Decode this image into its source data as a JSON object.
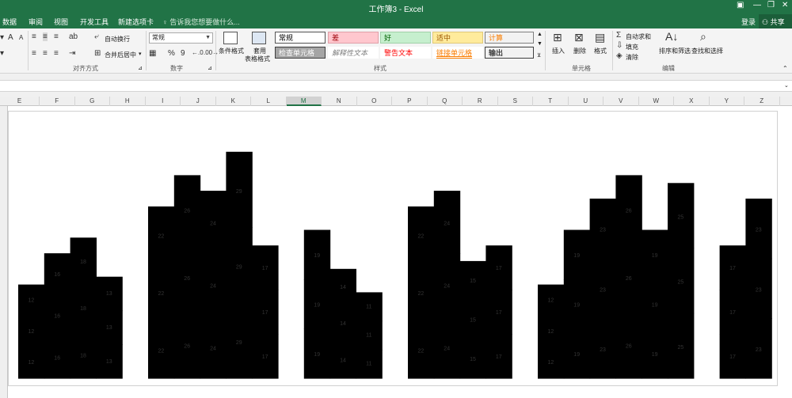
{
  "window": {
    "title": "工作簿3 - Excel",
    "controls": [
      "▣",
      "—",
      "❐",
      "✕"
    ]
  },
  "tabs": [
    "数据",
    "审阅",
    "视图",
    "开发工具",
    "新建选项卡"
  ],
  "tellme": "告诉我您想要做什么...",
  "account": {
    "login": "登录",
    "share": "共享"
  },
  "ribbon": {
    "align": {
      "wrap": "自动换行",
      "merge": "合并后居中",
      "group_label": "对齐方式"
    },
    "number": {
      "format": "常规",
      "percent": "%",
      "comma": "9",
      "group_label": "数字"
    },
    "styles": {
      "conditional": "条件格式",
      "table_format_1": "套用",
      "table_format_2": "表格格式",
      "cells": [
        {
          "label": "常规",
          "bg": "#ffffff",
          "fg": "#000000",
          "border": "#555555"
        },
        {
          "label": "差",
          "bg": "#ffc7ce",
          "fg": "#9c0006",
          "border": "#e0a0a8"
        },
        {
          "label": "好",
          "bg": "#c6efce",
          "fg": "#006100",
          "border": "#a0d0a8"
        },
        {
          "label": "适中",
          "bg": "#ffeb9c",
          "fg": "#9c5700",
          "border": "#e0c878"
        },
        {
          "label": "计算",
          "bg": "#f2f2f2",
          "fg": "#fa7d00",
          "border": "#7f7f7f"
        },
        {
          "label": "检查单元格",
          "bg": "#a5a5a5",
          "fg": "#ffffff",
          "border": "#3f3f3f"
        },
        {
          "label": "解释性文本",
          "bg": "#ffffff",
          "fg": "#7f7f7f",
          "border": "#ffffff"
        },
        {
          "label": "警告文本",
          "bg": "#ffffff",
          "fg": "#ff0000",
          "border": "#ffffff"
        },
        {
          "label": "链接单元格",
          "bg": "#ffffff",
          "fg": "#fa7d00",
          "border": "#ffffff"
        },
        {
          "label": "输出",
          "bg": "#f2f2f2",
          "fg": "#3f3f3f",
          "border": "#3f3f3f"
        }
      ],
      "group_label": "样式"
    },
    "cells": {
      "insert": "插入",
      "delete": "删除",
      "format": "格式",
      "group_label": "单元格"
    },
    "editing": {
      "autosum": "自动求和",
      "fill": "填充",
      "clear": "清除",
      "sort_filter": "排序和筛选",
      "find_select": "查找和选择",
      "group_label": "编辑"
    }
  },
  "columns": [
    "E",
    "F",
    "G",
    "H",
    "I",
    "J",
    "K",
    "L",
    "M",
    "N",
    "O",
    "P",
    "Q",
    "R",
    "S",
    "T",
    "U",
    "V",
    "W",
    "X",
    "Y",
    "Z"
  ],
  "selected_column": "M",
  "chart_data": {
    "type": "bar",
    "layout": "stacked",
    "bar_color": "#000000",
    "label_color": "#333333",
    "ylim": [
      0,
      100
    ],
    "groups": [
      [
        12,
        16,
        18,
        13
      ],
      [
        22,
        26,
        24,
        29,
        17
      ],
      [
        19,
        14,
        11
      ],
      [
        22,
        24,
        15,
        17
      ],
      [
        12,
        19,
        23,
        26,
        19,
        25
      ],
      [
        17,
        23
      ]
    ],
    "repeats": 3
  }
}
